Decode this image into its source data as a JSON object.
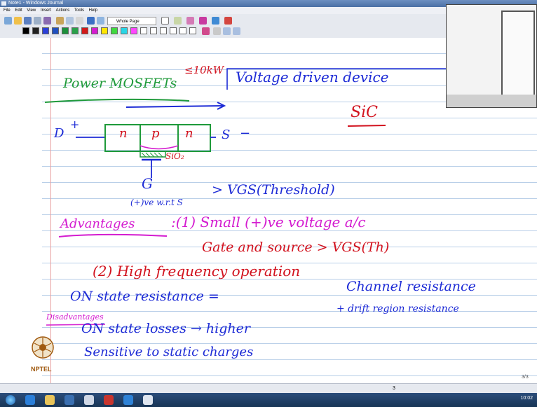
{
  "window": {
    "title": "Note1 - Windows Journal"
  },
  "menu": [
    "File",
    "Edit",
    "View",
    "Insert",
    "Actions",
    "Tools",
    "Help"
  ],
  "toolbar": {
    "zoom_select": "Whole Page"
  },
  "notes": {
    "title": "Power MOSFETs",
    "title_annotation": "≤10kW",
    "subtitle": "Voltage driven device",
    "sic": "SiC",
    "drain": "D",
    "drain_sign": "+",
    "source": "S",
    "source_sign": "−",
    "n1": "n",
    "p": "p",
    "n2": "n",
    "oxide": "SiO₂",
    "gate": "G",
    "gate_condition": "(+)ve  w.r.t S",
    "vgs_threshold": "> VGS(Threshold)",
    "advantages": "Advantages",
    "adv1_line1": ":(1) Small (+)ve voltage a/c",
    "adv1_line2": "Gate and source > VGS(Th)",
    "adv2": "(2) High frequency operation",
    "on_state": "ON state resistance =",
    "channel": "Channel resistance",
    "drift": "+ drift region resistance",
    "disadvantages": "Disadvantages",
    "losses": "ON state losses → higher",
    "static": "Sensitive to static charges"
  },
  "branding": {
    "logo_text": "NPTEL"
  },
  "status": {
    "page": "3",
    "page_count": "3/3",
    "clock": "10:02"
  },
  "colors": {
    "green": "#1f9a3a",
    "blue": "#1d2bd6",
    "red": "#d2121e",
    "magenta": "#d41cd0"
  }
}
